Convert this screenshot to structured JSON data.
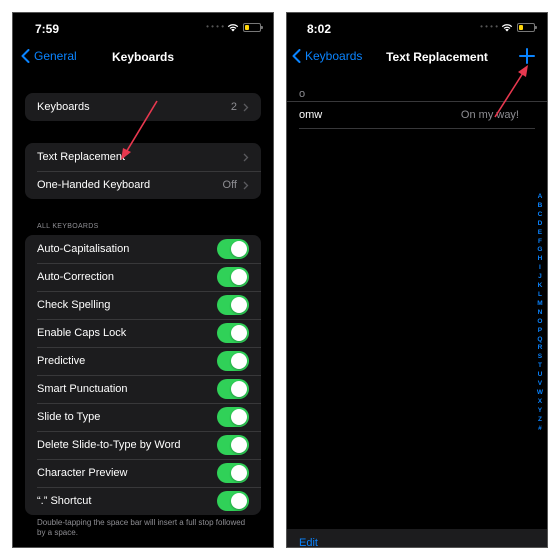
{
  "left_screen": {
    "status": {
      "time": "7:59",
      "battery_level": 0.25
    },
    "nav": {
      "back_label": "General",
      "title": "Keyboards"
    },
    "group1": [
      {
        "label": "Keyboards",
        "value": "2",
        "has_chevron": true
      }
    ],
    "group2": [
      {
        "label": "Text Replacement",
        "value": "",
        "has_chevron": true
      },
      {
        "label": "One-Handed Keyboard",
        "value": "Off",
        "has_chevron": true
      }
    ],
    "section_header": "ALL KEYBOARDS",
    "toggles": [
      {
        "label": "Auto-Capitalisation",
        "on": true
      },
      {
        "label": "Auto-Correction",
        "on": true
      },
      {
        "label": "Check Spelling",
        "on": true
      },
      {
        "label": "Enable Caps Lock",
        "on": true
      },
      {
        "label": "Predictive",
        "on": true
      },
      {
        "label": "Smart Punctuation",
        "on": true
      },
      {
        "label": "Slide to Type",
        "on": true
      },
      {
        "label": "Delete Slide-to-Type by Word",
        "on": true
      },
      {
        "label": "Character Preview",
        "on": true
      },
      {
        "label": "“.” Shortcut",
        "on": true
      }
    ],
    "footer_note": "Double-tapping the space bar will insert a full stop followed by a space."
  },
  "right_screen": {
    "status": {
      "time": "8:02",
      "battery_level": 0.25
    },
    "nav": {
      "back_label": "Keyboards",
      "title": "Text Replacement",
      "add_icon": "plus-icon"
    },
    "section_index": "o",
    "entries": [
      {
        "shortcut": "omw",
        "phrase": "On my way!"
      }
    ],
    "alphabet_index": [
      "A",
      "B",
      "C",
      "D",
      "E",
      "F",
      "G",
      "H",
      "I",
      "J",
      "K",
      "L",
      "M",
      "N",
      "O",
      "P",
      "Q",
      "R",
      "S",
      "T",
      "U",
      "V",
      "W",
      "X",
      "Y",
      "Z",
      "#"
    ],
    "toolbar": {
      "edit_label": "Edit"
    }
  },
  "colors": {
    "accent": "#0a84ff",
    "toggle_on": "#30d158",
    "annotation_arrow": "#e8384f",
    "cell_background": "#1c1c1e",
    "secondary_text": "#8e8e93"
  }
}
